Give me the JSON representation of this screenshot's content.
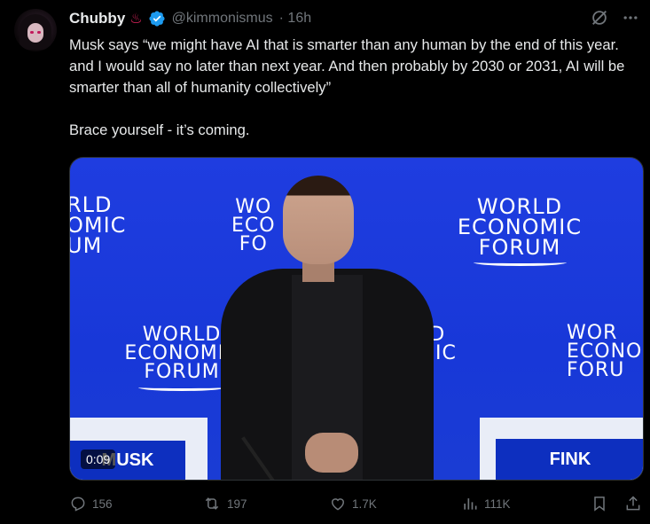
{
  "author": {
    "name": "Chubby",
    "emoji": "♨",
    "handle": "@kimmonismus",
    "time": "· 16h"
  },
  "tweet": {
    "paragraph1": "Musk says “we might have AI that is smarter than any human by the end of this year. and I would say no later than next year. And then probably by 2030 or 2031, AI will be smarter than all of humanity collectively”",
    "paragraph2": "Brace yourself - it’s coming."
  },
  "media": {
    "duration": "0:09",
    "wef_lines": [
      "WORLD",
      "ECONOMIC",
      "FORUM"
    ],
    "wef_left_partial": [
      "RLD",
      "OMIC",
      "UM"
    ],
    "wef_mid_partial": [
      "WO",
      "ECO",
      "FO"
    ],
    "wef_mid_lower_partial": [
      "LD",
      "MIC",
      "M"
    ],
    "wef_right_partial": [
      "WOR",
      "ECONO",
      "FORU"
    ],
    "nameplate_left": "MUSK",
    "nameplate_right": "FINK"
  },
  "stats": {
    "replies": "156",
    "reposts": "197",
    "likes": "1.7K",
    "views": "111K"
  },
  "colors": {
    "background": "#000000",
    "text": "#e7e9ea",
    "muted": "#71767b",
    "verified": "#1d9bf0",
    "wef_blue": "#1f3de0"
  },
  "icons": [
    "verified-badge-icon",
    "grok-icon",
    "more-icon",
    "reply-icon",
    "repost-icon",
    "like-icon",
    "views-icon",
    "bookmark-icon",
    "share-icon"
  ]
}
